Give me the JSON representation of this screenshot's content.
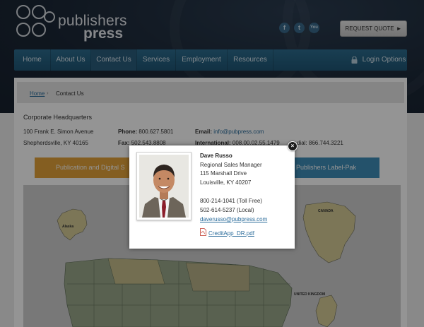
{
  "brand": {
    "name_line1": "publishers",
    "name_line2": "press"
  },
  "header": {
    "social": [
      "f",
      "t",
      "You"
    ],
    "request_quote": "REQUEST QUOTE"
  },
  "nav": {
    "items": [
      {
        "label": "Home"
      },
      {
        "label": "About Us"
      },
      {
        "label": "Contact Us",
        "active": true
      },
      {
        "label": "Services"
      },
      {
        "label": "Employment"
      },
      {
        "label": "Resources"
      }
    ],
    "login": "Login Options"
  },
  "breadcrumb": {
    "home": "Home",
    "current": "Contact Us"
  },
  "headquarters": {
    "title": "Corporate Headquarters",
    "address_line1": "100 Frank E. Simon Avenue",
    "address_line2": "Shepherdsville, KY 40165",
    "phone_label": "Phone:",
    "phone": "800.627.5801",
    "fax_label": "Fax:",
    "fax": "502.543.8808",
    "email_label": "Email:",
    "email": "info@pubpress.com",
    "intl_label": "International:",
    "intl": "008.00.02.55.1479",
    "dial": "dial: 866.744.3221"
  },
  "tabs": {
    "orange": "Publication and Digital S",
    "blue": "Publishers Label-Pak"
  },
  "map": {
    "label_alaska": "Alaska",
    "label_canada": "CANADA",
    "label_uk": "UNITED KINGDOM"
  },
  "modal": {
    "name": "Dave Russo",
    "title": "Regional Sales Manager",
    "street": "115 Marshall Drive",
    "city": "Louisville, KY 40207",
    "phone_toll_free": "800-214-1041 (Toll Free)",
    "phone_local": "502-614-5237 (Local)",
    "email": "daverusso@pubpress.com",
    "pdf": "CreditApp_DR.pdf",
    "close": "×"
  },
  "colors": {
    "header_bg": "#1b2736",
    "nav_bg": "#245f80",
    "accent_orange": "#e3a33a",
    "accent_blue": "#3f8db8",
    "link": "#2a6b9a"
  }
}
